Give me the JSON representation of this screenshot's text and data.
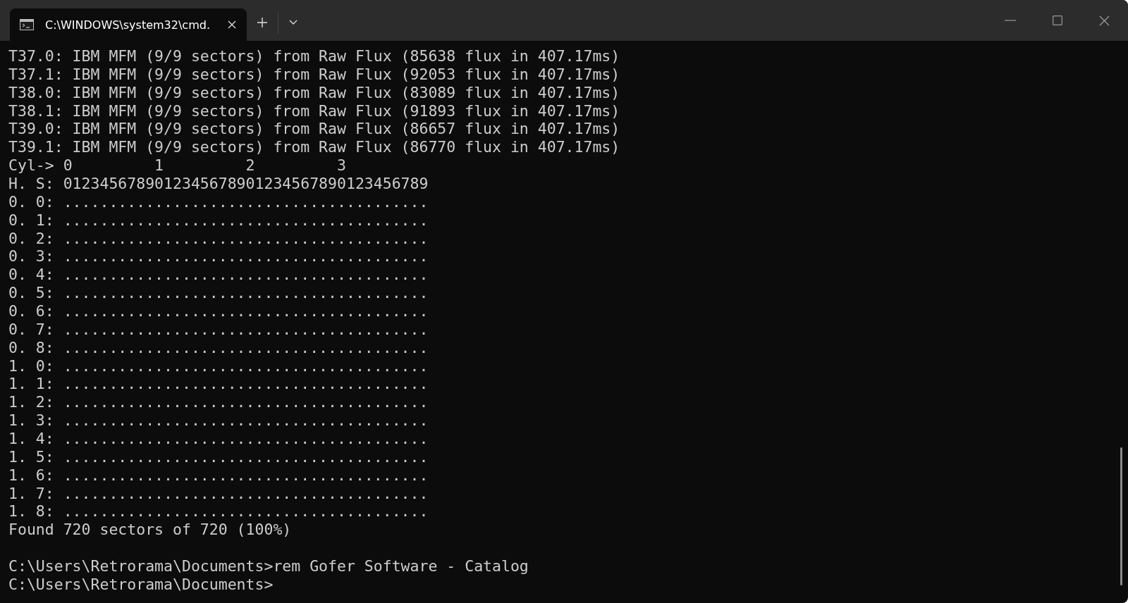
{
  "window": {
    "tabs": [
      {
        "title": "C:\\WINDOWS\\system32\\cmd.",
        "selected": true
      }
    ]
  },
  "terminal": {
    "lines": [
      {
        "text": "T37.0: IBM MFM (9/9 sectors) from Raw Flux (85638 flux in 407.17ms)"
      },
      {
        "text": "T37.1: IBM MFM (9/9 sectors) from Raw Flux (92053 flux in 407.17ms)"
      },
      {
        "text": "T38.0: IBM MFM (9/9 sectors) from Raw Flux (83089 flux in 407.17ms)"
      },
      {
        "text": "T38.1: IBM MFM (9/9 sectors) from Raw Flux (91893 flux in 407.17ms)"
      },
      {
        "text": "T39.0: IBM MFM (9/9 sectors) from Raw Flux (86657 flux in 407.17ms)"
      },
      {
        "text": "T39.1: IBM MFM (9/9 sectors) from Raw Flux (86770 flux in 407.17ms)"
      },
      {
        "text": "Cyl-> 0         1         2         3"
      },
      {
        "text": "H. S: 0123456789012345678901234567890123456789"
      },
      {
        "text": "0. 0: ........................................"
      },
      {
        "text": "0. 1: ........................................"
      },
      {
        "text": "0. 2: ........................................"
      },
      {
        "text": "0. 3: ........................................"
      },
      {
        "text": "0. 4: ........................................"
      },
      {
        "text": "0. 5: ........................................"
      },
      {
        "text": "0. 6: ........................................"
      },
      {
        "text": "0. 7: ........................................"
      },
      {
        "text": "0. 8: ........................................"
      },
      {
        "text": "1. 0: ........................................"
      },
      {
        "text": "1. 1: ........................................"
      },
      {
        "text": "1. 2: ........................................"
      },
      {
        "text": "1. 3: ........................................"
      },
      {
        "text": "1. 4: ........................................"
      },
      {
        "text": "1. 5: ........................................"
      },
      {
        "text": "1. 6: ........................................"
      },
      {
        "text": "1. 7: ........................................"
      },
      {
        "text": "1. 8: ........................................"
      },
      {
        "text": "Found 720 sectors of 720 (100%)"
      },
      {
        "text": "C:\\Users\\Retrorama\\Documents>rem Gofer Software - Catalog",
        "blank_before": true
      },
      {
        "text": "C:\\Users\\Retrorama\\Documents>"
      }
    ]
  }
}
